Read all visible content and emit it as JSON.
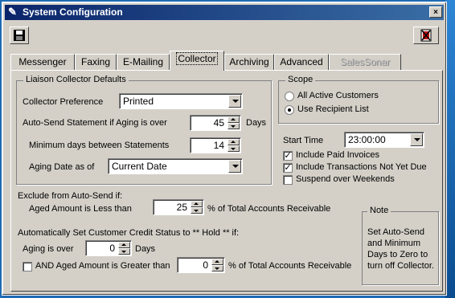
{
  "window": {
    "title": "System Configuration",
    "close_glyph": "×"
  },
  "toolbar": {
    "save_icon": "floppy-disk-icon",
    "exit_icon": "exit-icon"
  },
  "tabs": [
    {
      "label": "Messenger",
      "active": false,
      "disabled": false
    },
    {
      "label": "Faxing",
      "active": false,
      "disabled": false
    },
    {
      "label": "E-Mailing",
      "active": false,
      "disabled": false
    },
    {
      "label": "Collector",
      "active": true,
      "disabled": false
    },
    {
      "label": "Archiving",
      "active": false,
      "disabled": false
    },
    {
      "label": "Advanced",
      "active": false,
      "disabled": false
    },
    {
      "label": "SalesSonar",
      "active": false,
      "disabled": true
    }
  ],
  "liaison": {
    "group_title": "Liaison Collector Defaults",
    "pref_label": "Collector Preference",
    "pref_value": "Printed",
    "autosend_label": "Auto-Send Statement if Aging is over",
    "autosend_value": "45",
    "autosend_unit": "Days",
    "mindays_label": "Minimum days between Statements",
    "mindays_value": "14",
    "agingdate_label": "Aging Date as of",
    "agingdate_value": "Current Date"
  },
  "scope": {
    "group_title": "Scope",
    "opt_all": "All Active Customers",
    "opt_recipient": "Use Recipient List",
    "selected": "recipient"
  },
  "schedule": {
    "start_label": "Start Time",
    "start_value": "23:00:00",
    "include_paid": "Include Paid Invoices",
    "include_paid_checked": true,
    "include_not_due": "Include Transactions Not Yet Due",
    "include_not_due_checked": true,
    "suspend_weekends": "Suspend over Weekends",
    "suspend_weekends_checked": false
  },
  "exclude": {
    "heading": "Exclude from Auto-Send if:",
    "aged_label": "Aged Amount is Less than",
    "aged_value": "25",
    "aged_suffix": "% of Total Accounts Receivable"
  },
  "hold": {
    "heading": "Automatically Set Customer Credit Status to ** Hold ** if:",
    "aging_label": "Aging is over",
    "aging_value": "0",
    "aging_unit": "Days",
    "and_label": "AND Aged Amount is Greater than",
    "and_checked": false,
    "and_value": "0",
    "and_suffix": "% of Total Accounts Receivable"
  },
  "note": {
    "title": "Note",
    "text": "Set Auto-Send and Minimum Days to Zero to turn off Collector."
  }
}
